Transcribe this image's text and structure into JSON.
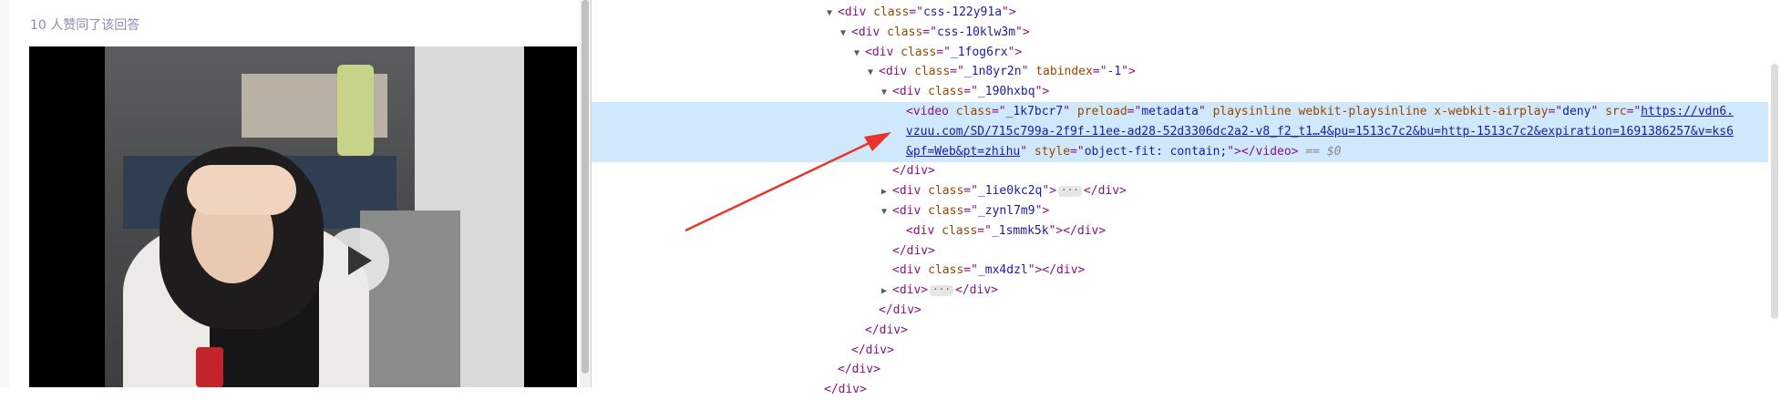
{
  "left_page": {
    "upvote_text": "10 人赞同了该回答",
    "video": {
      "play_icon": "play-icon"
    }
  },
  "devtools": {
    "gutter_dots": "···",
    "lines": [
      {
        "indent": 18,
        "tri": "▼",
        "html": [
          [
            "tag",
            "<div "
          ],
          [
            "attr",
            "class"
          ],
          [
            "tag",
            "=\""
          ],
          [
            "val",
            "css-122y91a"
          ],
          [
            "tag",
            "\">"
          ]
        ]
      },
      {
        "indent": 19,
        "tri": "▼",
        "html": [
          [
            "tag",
            "<div "
          ],
          [
            "attr",
            "class"
          ],
          [
            "tag",
            "=\""
          ],
          [
            "val",
            "css-10klw3m"
          ],
          [
            "tag",
            "\">"
          ]
        ]
      },
      {
        "indent": 20,
        "tri": "▼",
        "html": [
          [
            "tag",
            "<div "
          ],
          [
            "attr",
            "class"
          ],
          [
            "tag",
            "=\""
          ],
          [
            "val",
            "_1fog6rx"
          ],
          [
            "tag",
            "\">"
          ]
        ]
      },
      {
        "indent": 21,
        "tri": "▼",
        "html": [
          [
            "tag",
            "<div "
          ],
          [
            "attr",
            "class"
          ],
          [
            "tag",
            "=\""
          ],
          [
            "val",
            "_1n8yr2n"
          ],
          [
            "tag",
            "\" "
          ],
          [
            "attr",
            "tabindex"
          ],
          [
            "tag",
            "=\""
          ],
          [
            "val",
            "-1"
          ],
          [
            "tag",
            "\">"
          ]
        ]
      },
      {
        "indent": 22,
        "tri": "▼",
        "html": [
          [
            "tag",
            "<div "
          ],
          [
            "attr",
            "class"
          ],
          [
            "tag",
            "=\""
          ],
          [
            "val",
            "_190hxbq"
          ],
          [
            "tag",
            "\">"
          ]
        ]
      },
      {
        "indent": 23,
        "tri": "",
        "selected": true,
        "html": [
          [
            "tag",
            "<video "
          ],
          [
            "attr",
            "class"
          ],
          [
            "tag",
            "=\""
          ],
          [
            "val",
            "_1k7bcr7"
          ],
          [
            "tag",
            "\" "
          ],
          [
            "attr",
            "preload"
          ],
          [
            "tag",
            "=\""
          ],
          [
            "val",
            "metadata"
          ],
          [
            "tag",
            "\" "
          ],
          [
            "attr",
            "playsinline webkit-playsinline x-webkit-airplay"
          ],
          [
            "tag",
            "=\""
          ],
          [
            "val",
            "deny"
          ],
          [
            "tag",
            "\" "
          ],
          [
            "attr",
            "src"
          ],
          [
            "tag",
            "=\""
          ],
          [
            "link",
            "https://vdn6."
          ]
        ]
      },
      {
        "indent": 23,
        "tri": "",
        "selected": true,
        "html": [
          [
            "link",
            "vzuu.com/SD/715c799a-2f9f-11ee-ad28-52d3306dc2a2-v8_f2_t1…4&pu=1513c7c2&bu=http-1513c7c2&expiration=1691386257&v=ks6"
          ]
        ]
      },
      {
        "indent": 23,
        "tri": "",
        "selected": true,
        "html": [
          [
            "link",
            "&pf=Web&pt=zhihu"
          ],
          [
            "tag",
            "\" "
          ],
          [
            "attr",
            "style"
          ],
          [
            "tag",
            "=\""
          ],
          [
            "val",
            "object-fit: contain;"
          ],
          [
            "tag",
            "\"></video>"
          ],
          [
            "ref",
            " == $0"
          ]
        ]
      },
      {
        "indent": 22,
        "tri": "",
        "html": [
          [
            "tag",
            "</div>"
          ]
        ]
      },
      {
        "indent": 22,
        "tri": "▶",
        "html": [
          [
            "tag",
            "<div "
          ],
          [
            "attr",
            "class"
          ],
          [
            "tag",
            "=\""
          ],
          [
            "val",
            "_1ie0kc2q"
          ],
          [
            "tag",
            "\">"
          ],
          [
            "ell",
            "···"
          ],
          [
            "tag",
            "</div>"
          ]
        ]
      },
      {
        "indent": 22,
        "tri": "▼",
        "html": [
          [
            "tag",
            "<div "
          ],
          [
            "attr",
            "class"
          ],
          [
            "tag",
            "=\""
          ],
          [
            "val",
            "_zynl7m9"
          ],
          [
            "tag",
            "\">"
          ]
        ]
      },
      {
        "indent": 23,
        "tri": "",
        "html": [
          [
            "tag",
            "<div "
          ],
          [
            "attr",
            "class"
          ],
          [
            "tag",
            "=\""
          ],
          [
            "val",
            "_1smmk5k"
          ],
          [
            "tag",
            "\"></div>"
          ]
        ]
      },
      {
        "indent": 22,
        "tri": "",
        "html": [
          [
            "tag",
            "</div>"
          ]
        ]
      },
      {
        "indent": 22,
        "tri": "",
        "html": [
          [
            "tag",
            "<div "
          ],
          [
            "attr",
            "class"
          ],
          [
            "tag",
            "=\""
          ],
          [
            "val",
            "_mx4dzl"
          ],
          [
            "tag",
            "\"></div>"
          ]
        ]
      },
      {
        "indent": 22,
        "tri": "▶",
        "html": [
          [
            "tag",
            "<div>"
          ],
          [
            "ell",
            "···"
          ],
          [
            "tag",
            "</div>"
          ]
        ]
      },
      {
        "indent": 21,
        "tri": "",
        "html": [
          [
            "tag",
            "</div>"
          ]
        ]
      },
      {
        "indent": 20,
        "tri": "",
        "html": [
          [
            "tag",
            "</div>"
          ]
        ]
      },
      {
        "indent": 19,
        "tri": "",
        "html": [
          [
            "tag",
            "</div>"
          ]
        ]
      },
      {
        "indent": 18,
        "tri": "",
        "html": [
          [
            "tag",
            "</div>"
          ]
        ]
      },
      {
        "indent": 17,
        "tri": "",
        "html": [
          [
            "tag",
            "</div>"
          ]
        ]
      }
    ]
  },
  "annotation": {
    "arrow_color": "#e8352b"
  }
}
